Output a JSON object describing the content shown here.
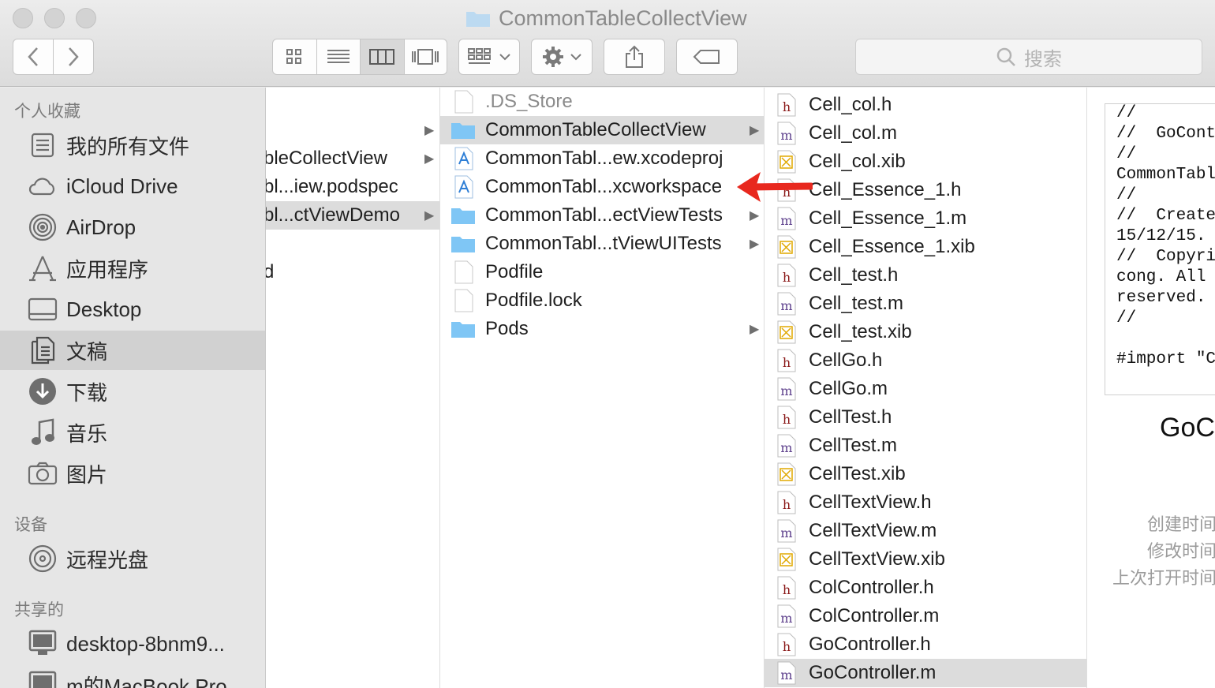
{
  "window": {
    "title": "CommonTableCollectView"
  },
  "toolbar": {
    "search_placeholder": "搜索"
  },
  "sidebar": {
    "sections": [
      {
        "label": "个人收藏"
      },
      {
        "label": "设备"
      },
      {
        "label": "共享的"
      }
    ],
    "favorites": [
      {
        "label": "我的所有文件",
        "icon": "all-files-icon"
      },
      {
        "label": "iCloud Drive",
        "icon": "cloud-icon"
      },
      {
        "label": "AirDrop",
        "icon": "airdrop-icon"
      },
      {
        "label": "应用程序",
        "icon": "applications-icon"
      },
      {
        "label": "Desktop",
        "icon": "desktop-icon"
      },
      {
        "label": "文稿",
        "icon": "documents-icon",
        "selected": true
      },
      {
        "label": "下载",
        "icon": "download-icon"
      },
      {
        "label": "音乐",
        "icon": "music-icon"
      },
      {
        "label": "图片",
        "icon": "camera-icon"
      }
    ],
    "devices": [
      {
        "label": "远程光盘",
        "icon": "disc-icon"
      }
    ],
    "shared": [
      {
        "label": "desktop-8bnm9...",
        "icon": "monitor-icon"
      },
      {
        "label": "m的MacBook Pro",
        "icon": "monitor-icon"
      }
    ]
  },
  "column1": {
    "items": [
      {
        "name": "",
        "arrow": true
      },
      {
        "name": "bleCollectView",
        "arrow": true
      },
      {
        "name": "bl...iew.podspec",
        "arrow": false
      },
      {
        "name": "bl...ctViewDemo",
        "arrow": true,
        "selected": true
      },
      {
        "name": "d",
        "arrow": false
      }
    ]
  },
  "column2": {
    "items": [
      {
        "name": ".DS_Store",
        "kind": "file",
        "arrow": false,
        "dim": true
      },
      {
        "name": "CommonTableCollectView",
        "kind": "folder",
        "arrow": true,
        "selected": true
      },
      {
        "name": "CommonTabl...ew.xcodeproj",
        "kind": "xcode",
        "arrow": false
      },
      {
        "name": "CommonTabl...xcworkspace",
        "kind": "xcode",
        "arrow": false
      },
      {
        "name": "CommonTabl...ectViewTests",
        "kind": "folder",
        "arrow": true
      },
      {
        "name": "CommonTabl...tViewUITests",
        "kind": "folder",
        "arrow": true
      },
      {
        "name": "Podfile",
        "kind": "file",
        "arrow": false
      },
      {
        "name": "Podfile.lock",
        "kind": "file",
        "arrow": false
      },
      {
        "name": "Pods",
        "kind": "folder",
        "arrow": true
      }
    ]
  },
  "column3": {
    "items": [
      {
        "name": "Cell_col.h",
        "kind": "h"
      },
      {
        "name": "Cell_col.m",
        "kind": "m"
      },
      {
        "name": "Cell_col.xib",
        "kind": "xib"
      },
      {
        "name": "Cell_Essence_1.h",
        "kind": "h"
      },
      {
        "name": "Cell_Essence_1.m",
        "kind": "m"
      },
      {
        "name": "Cell_Essence_1.xib",
        "kind": "xib"
      },
      {
        "name": "Cell_test.h",
        "kind": "h"
      },
      {
        "name": "Cell_test.m",
        "kind": "m"
      },
      {
        "name": "Cell_test.xib",
        "kind": "xib"
      },
      {
        "name": "CellGo.h",
        "kind": "h"
      },
      {
        "name": "CellGo.m",
        "kind": "m"
      },
      {
        "name": "CellTest.h",
        "kind": "h"
      },
      {
        "name": "CellTest.m",
        "kind": "m"
      },
      {
        "name": "CellTest.xib",
        "kind": "xib"
      },
      {
        "name": "CellTextView.h",
        "kind": "h"
      },
      {
        "name": "CellTextView.m",
        "kind": "m"
      },
      {
        "name": "CellTextView.xib",
        "kind": "xib"
      },
      {
        "name": "ColController.h",
        "kind": "h"
      },
      {
        "name": "ColController.m",
        "kind": "m"
      },
      {
        "name": "GoController.h",
        "kind": "h"
      },
      {
        "name": "GoController.m",
        "kind": "m",
        "selected": true
      }
    ]
  },
  "preview": {
    "code_lines": [
      "//",
      "//  GoCont",
      "//",
      "CommonTabl",
      "//",
      "//  Create",
      "15/12/15.",
      "//  Copyri",
      "cong. All",
      "reserved.",
      "//",
      "",
      "#import \"C"
    ],
    "file_name": "GoC",
    "meta_labels": [
      "创建时间",
      "修改时间",
      "上次打开时间"
    ]
  },
  "colors": {
    "folder": "#7fc6f5",
    "annotation_arrow": "#e8281e",
    "h_letter": "#8b1a1a",
    "m_letter": "#5b3d8a",
    "xib_mark": "#e0a800"
  }
}
